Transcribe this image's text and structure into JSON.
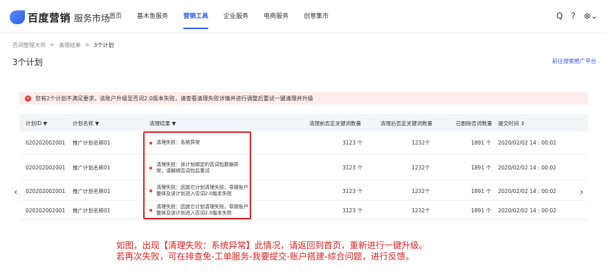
{
  "header": {
    "brand": "百度营销",
    "brand_sub": "服务市场",
    "nav": [
      "首页",
      "基木鱼服务",
      "营销工具",
      "企业服务",
      "电商服务",
      "创意集市"
    ],
    "active_nav": "营销工具",
    "icons": [
      "search-icon",
      "help-icon",
      "user-icon"
    ],
    "search_glyph": "Q",
    "help_glyph": "?",
    "user_glyph": "⊗⌄"
  },
  "breadcrumb": [
    "否词管理大师",
    ">",
    "清理结果",
    ">",
    "3个计划"
  ],
  "page_title": "3个计划",
  "top_link": "前往搜索推广平台",
  "alert": {
    "icon": "✕",
    "text": "您有2个计划不满足要求，该账户升级至否词2.0版本失败，请查看清理失败详情并进行调整后重试一键清理并升级"
  },
  "table": {
    "headers": [
      "计划ID ▼",
      "计划名称 ▼",
      "清理结果 ▼",
      "清理前否定关键词数量",
      "清理后否定关键词数量",
      "已删除否词数量",
      "提交时间 ⇕"
    ],
    "rows": [
      {
        "id": "020202002001",
        "name": "推广计划名称01",
        "result": "清理失败：系统异常",
        "before": "3123 个",
        "after": "1232个",
        "deleted": "1891 个",
        "time": "2020/02/02 14 : 00:02"
      },
      {
        "id": "020202002001",
        "name": "推广计划名称01",
        "result": "清理失败：该计划绑定的否词包数据异常，请解绑否词包后重试",
        "before": "3123 个",
        "after": "1232个",
        "deleted": "1891 个",
        "time": "2020/02/02 14 : 00:02"
      },
      {
        "id": "020202002001",
        "name": "推广计划名称01",
        "result": "清理失败：因其它计划清理失败，导致账户整体及该计划进入否词2.0版本失败",
        "before": "3123 个",
        "after": "1232个",
        "deleted": "1891 个",
        "time": "2020/02/02 14 : 00:02"
      },
      {
        "id": "020202002001",
        "name": "推广计划名称01",
        "result": "清理失败：因其它计划清理失败，导致账户整体及该计划进入否词2.0版本失败",
        "before": "3123 个",
        "after": "1232个",
        "deleted": "1891 个",
        "time": "2020/02/02 14 : 00:02"
      }
    ]
  },
  "pager": {
    "prev": "‹",
    "next": "›"
  },
  "note": {
    "line1": "如图，出现【清理失败：系统异常】此情况，请返回到首页，重新进行一键升级。",
    "line2": "若再次失败，可在排查免-工单服务-我要提交-账户搭建-综合问题，进行反馈。"
  },
  "colors": {
    "accent": "#2f5ce6",
    "error": "#e53935",
    "highlight": "#e02020"
  }
}
